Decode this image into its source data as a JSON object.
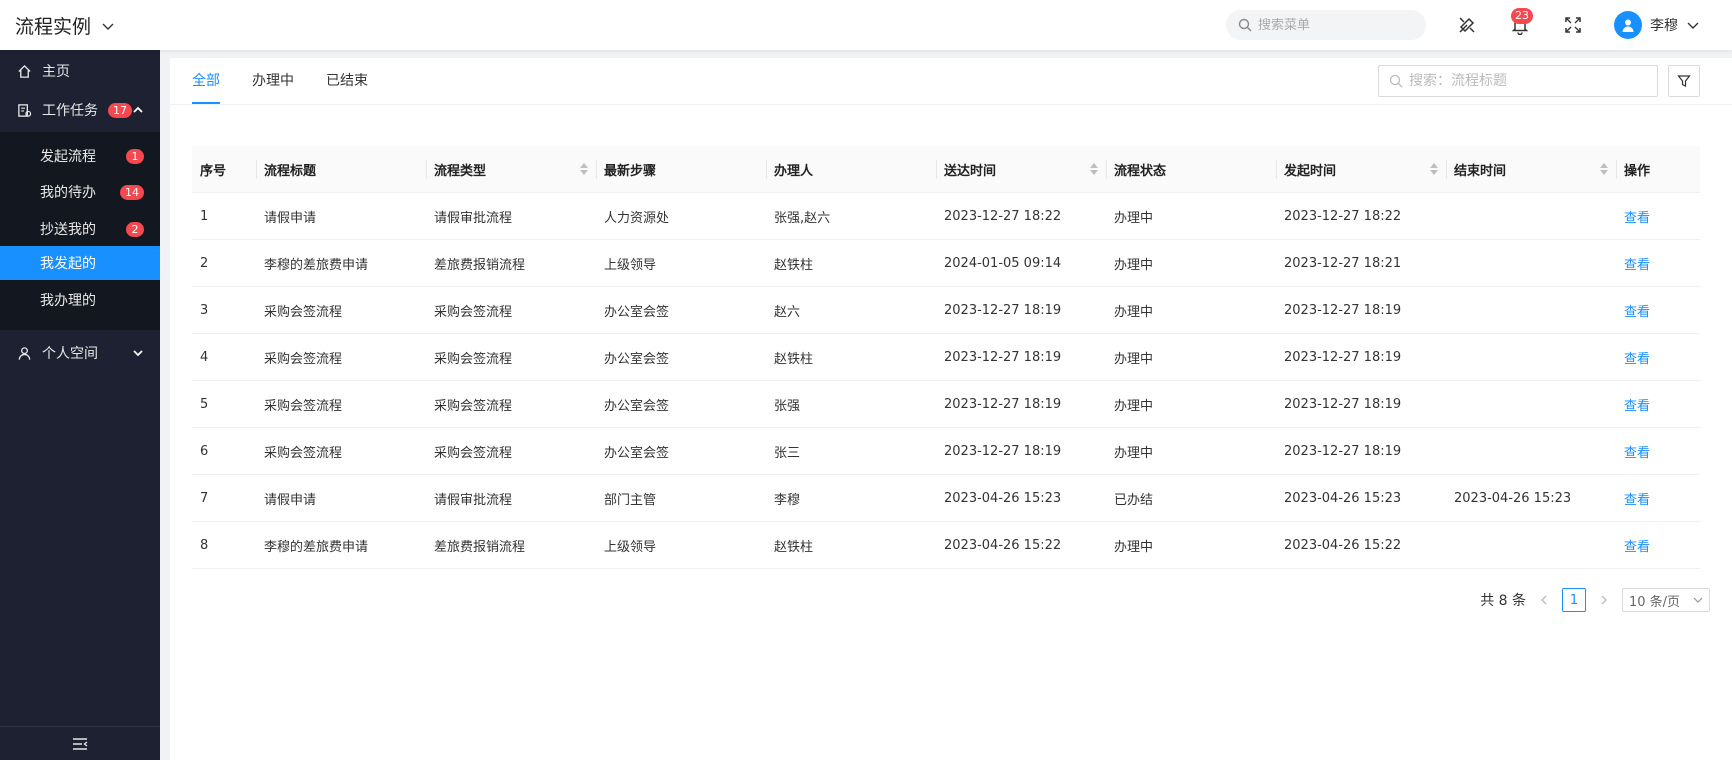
{
  "header": {
    "title": "流程实例",
    "search_placeholder": "搜索菜单",
    "notification_count": "23",
    "user_name": "李穆"
  },
  "sidebar": {
    "home": "主页",
    "tasks": {
      "label": "工作任务",
      "badge": "17"
    },
    "sub_items": [
      {
        "label": "发起流程",
        "badge": "1"
      },
      {
        "label": "我的待办",
        "badge": "14"
      },
      {
        "label": "抄送我的",
        "badge": "2"
      },
      {
        "label": "我发起的",
        "badge": ""
      },
      {
        "label": "我办理的",
        "badge": ""
      }
    ],
    "personal": "个人空间"
  },
  "tabs": [
    "全部",
    "办理中",
    "已结束"
  ],
  "search": {
    "placeholder": "搜索：流程标题"
  },
  "table": {
    "columns": [
      "序号",
      "流程标题",
      "流程类型",
      "最新步骤",
      "办理人",
      "送达时间",
      "流程状态",
      "发起时间",
      "结束时间",
      "操作"
    ],
    "rows": [
      [
        "1",
        "请假申请",
        "请假审批流程",
        "人力资源处",
        "张强,赵六",
        "2023-12-27 18:22",
        "办理中",
        "2023-12-27 18:22",
        "",
        "查看"
      ],
      [
        "2",
        "李穆的差旅费申请",
        "差旅费报销流程",
        "上级领导",
        "赵铁柱",
        "2024-01-05 09:14",
        "办理中",
        "2023-12-27 18:21",
        "",
        "查看"
      ],
      [
        "3",
        "采购会签流程",
        "采购会签流程",
        "办公室会签",
        "赵六",
        "2023-12-27 18:19",
        "办理中",
        "2023-12-27 18:19",
        "",
        "查看"
      ],
      [
        "4",
        "采购会签流程",
        "采购会签流程",
        "办公室会签",
        "赵铁柱",
        "2023-12-27 18:19",
        "办理中",
        "2023-12-27 18:19",
        "",
        "查看"
      ],
      [
        "5",
        "采购会签流程",
        "采购会签流程",
        "办公室会签",
        "张强",
        "2023-12-27 18:19",
        "办理中",
        "2023-12-27 18:19",
        "",
        "查看"
      ],
      [
        "6",
        "采购会签流程",
        "采购会签流程",
        "办公室会签",
        "张三",
        "2023-12-27 18:19",
        "办理中",
        "2023-12-27 18:19",
        "",
        "查看"
      ],
      [
        "7",
        "请假申请",
        "请假审批流程",
        "部门主管",
        "李穆",
        "2023-04-26 15:23",
        "已办结",
        "2023-04-26 15:23",
        "2023-04-26 15:23",
        "查看"
      ],
      [
        "8",
        "李穆的差旅费申请",
        "差旅费报销流程",
        "上级领导",
        "赵铁柱",
        "2023-04-26 15:22",
        "办理中",
        "2023-04-26 15:22",
        "",
        "查看"
      ]
    ]
  },
  "pagination": {
    "total": "共 8 条",
    "current": "1",
    "page_size": "10 条/页"
  },
  "colors": {
    "accent": "#1890ff",
    "badge": "#f5484f",
    "sidebar_bg": "#1d2131"
  }
}
